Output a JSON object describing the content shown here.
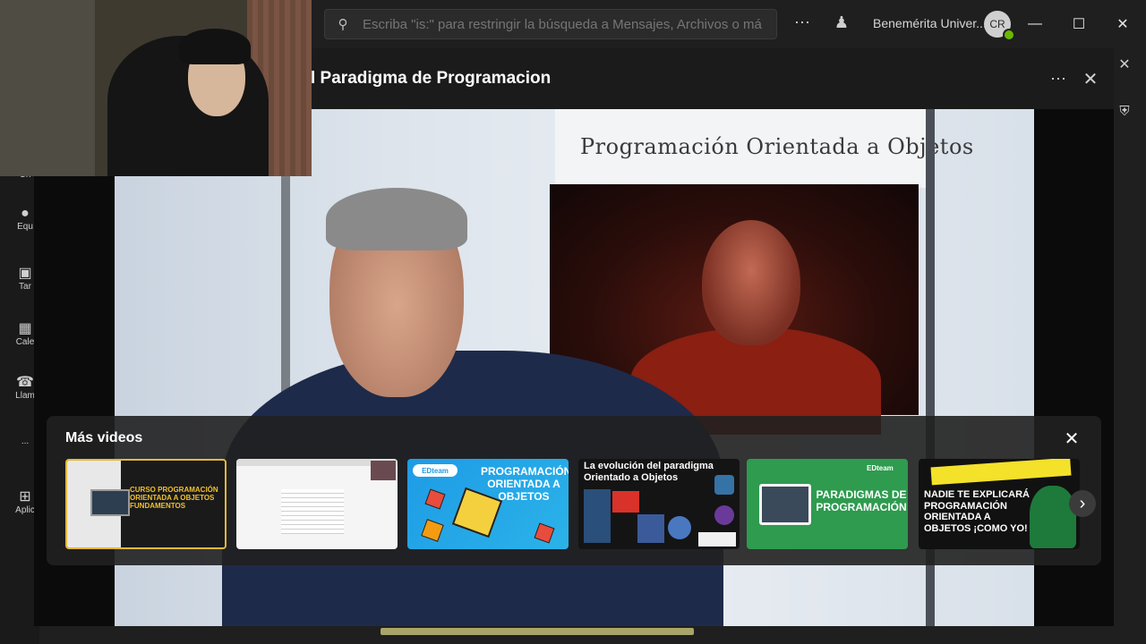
{
  "topbar": {
    "search_placeholder": "Escriba \"is:\" para restringir la búsqueda a Mensajes, Archivos o má",
    "org_name": "Benemérita Univer...",
    "avatar_initials": "CR",
    "presence_color": "#6bb700"
  },
  "rail": {
    "items": [
      {
        "label": "Ch",
        "icon": "chat-icon"
      },
      {
        "label": "Equ",
        "icon": "teams-icon"
      },
      {
        "label": "Tar",
        "icon": "tasks-icon"
      },
      {
        "label": "Cale",
        "icon": "calendar-icon"
      },
      {
        "label": "Llam",
        "icon": "calls-icon"
      },
      {
        "label": "...",
        "icon": "more-icon"
      },
      {
        "label": "Aplic",
        "icon": "apps-icon"
      }
    ]
  },
  "viewer": {
    "title": "l Paradigma de Programacion",
    "board_text": "Programación Orientada a Objetos"
  },
  "more_videos": {
    "title": "Más videos",
    "thumbnails": [
      {
        "text": "CURSO PROGRAMACIÓN ORIENTADA A OBJETOS FUNDAMENTOS"
      },
      {
        "text": ""
      },
      {
        "text": "PROGRAMACIÓN ORIENTADA A OBJETOS",
        "badge": "EDteam"
      },
      {
        "text": "La evolución del paradigma Orientado a Objetos"
      },
      {
        "text": "PARADIGMAS DE PROGRAMACIÓN",
        "badge": "EDteam"
      },
      {
        "text": "NADIE TE EXPLICARÁ PROGRAMACIÓN ORIENTADA A OBJETOS ¡COMO YO!"
      }
    ]
  },
  "colors": {
    "accent_border": "#e5b83a",
    "edteam_blue": "#1e9be6",
    "green_thumb": "#2e9b4f"
  }
}
